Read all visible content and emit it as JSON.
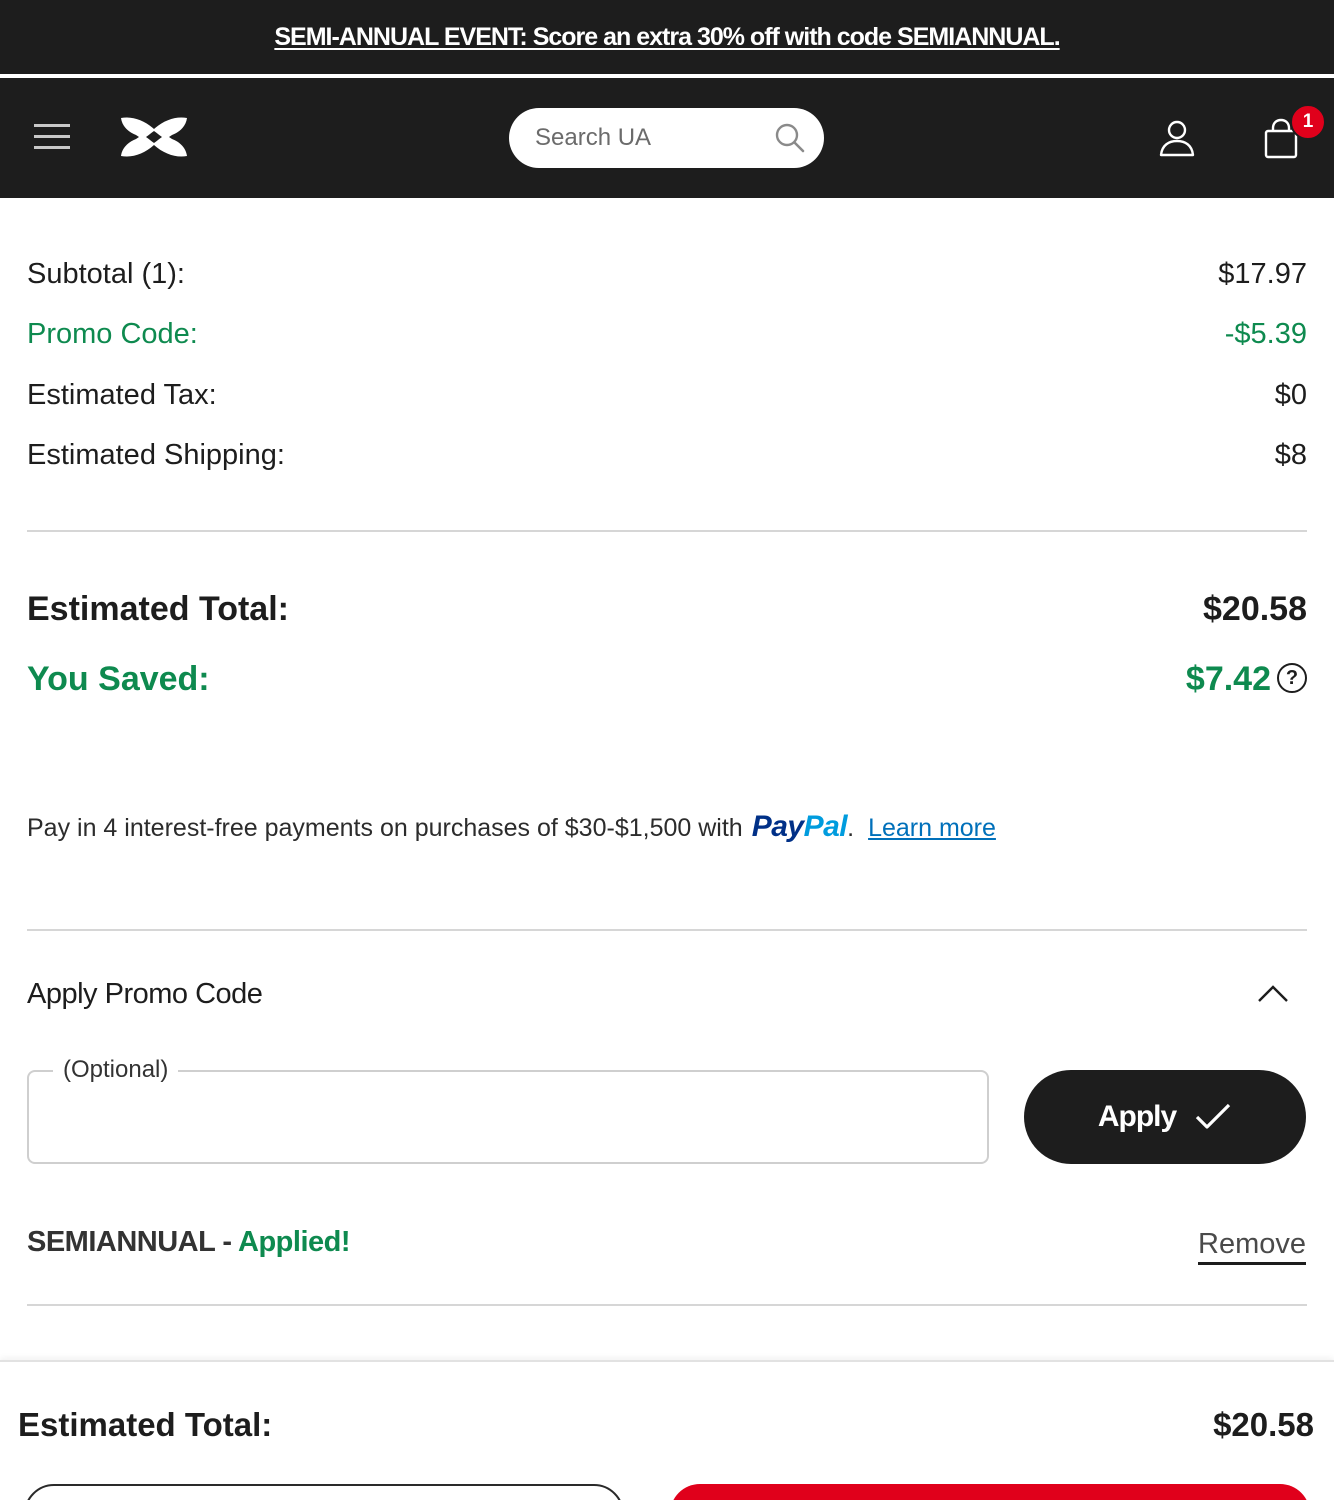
{
  "banner": {
    "text": "SEMI-ANNUAL EVENT: Score an extra 30% off with code SEMIANNUAL."
  },
  "header": {
    "menu_icon": "hamburger-menu-icon",
    "logo_icon": "under-armour-logo",
    "search_placeholder": "Search UA",
    "search_icon": "search-icon",
    "account_icon": "user-icon",
    "bag_icon": "shopping-bag-icon",
    "bag_count": "1"
  },
  "summary": {
    "subtotal_label": "Subtotal (1):",
    "subtotal_value": "$17.97",
    "promo_label": "Promo Code:",
    "promo_value": "-$5.39",
    "tax_label": "Estimated Tax:",
    "tax_value": "$0",
    "shipping_label": "Estimated Shipping:",
    "shipping_value": "$8",
    "total_label": "Estimated Total:",
    "total_value": "$20.58",
    "saved_label": "You Saved:",
    "saved_value": "$7.42",
    "help_glyph": "?"
  },
  "paypal": {
    "text": "Pay in 4 interest-free payments on purchases of $30-$1,500 with",
    "logo_pay": "Pay",
    "logo_pal": "Pal",
    "period": ".",
    "learn_more": "Learn more"
  },
  "promo_section": {
    "title": "Apply Promo Code",
    "field_label": "(Optional)",
    "field_value": "",
    "apply_label": "Apply",
    "applied_code": "SEMIANNUAL",
    "applied_separator": " - ",
    "applied_status": "Applied!",
    "remove_label": "Remove"
  },
  "footer": {
    "total_label": "Estimated Total:",
    "total_value": "$20.58"
  },
  "colors": {
    "dark": "#1d1d1d",
    "green": "#0e8a4f",
    "badge_red": "#e0001b",
    "paypal_blue": "#003087",
    "paypal_light_blue": "#009cde",
    "link_blue": "#0070ba"
  }
}
